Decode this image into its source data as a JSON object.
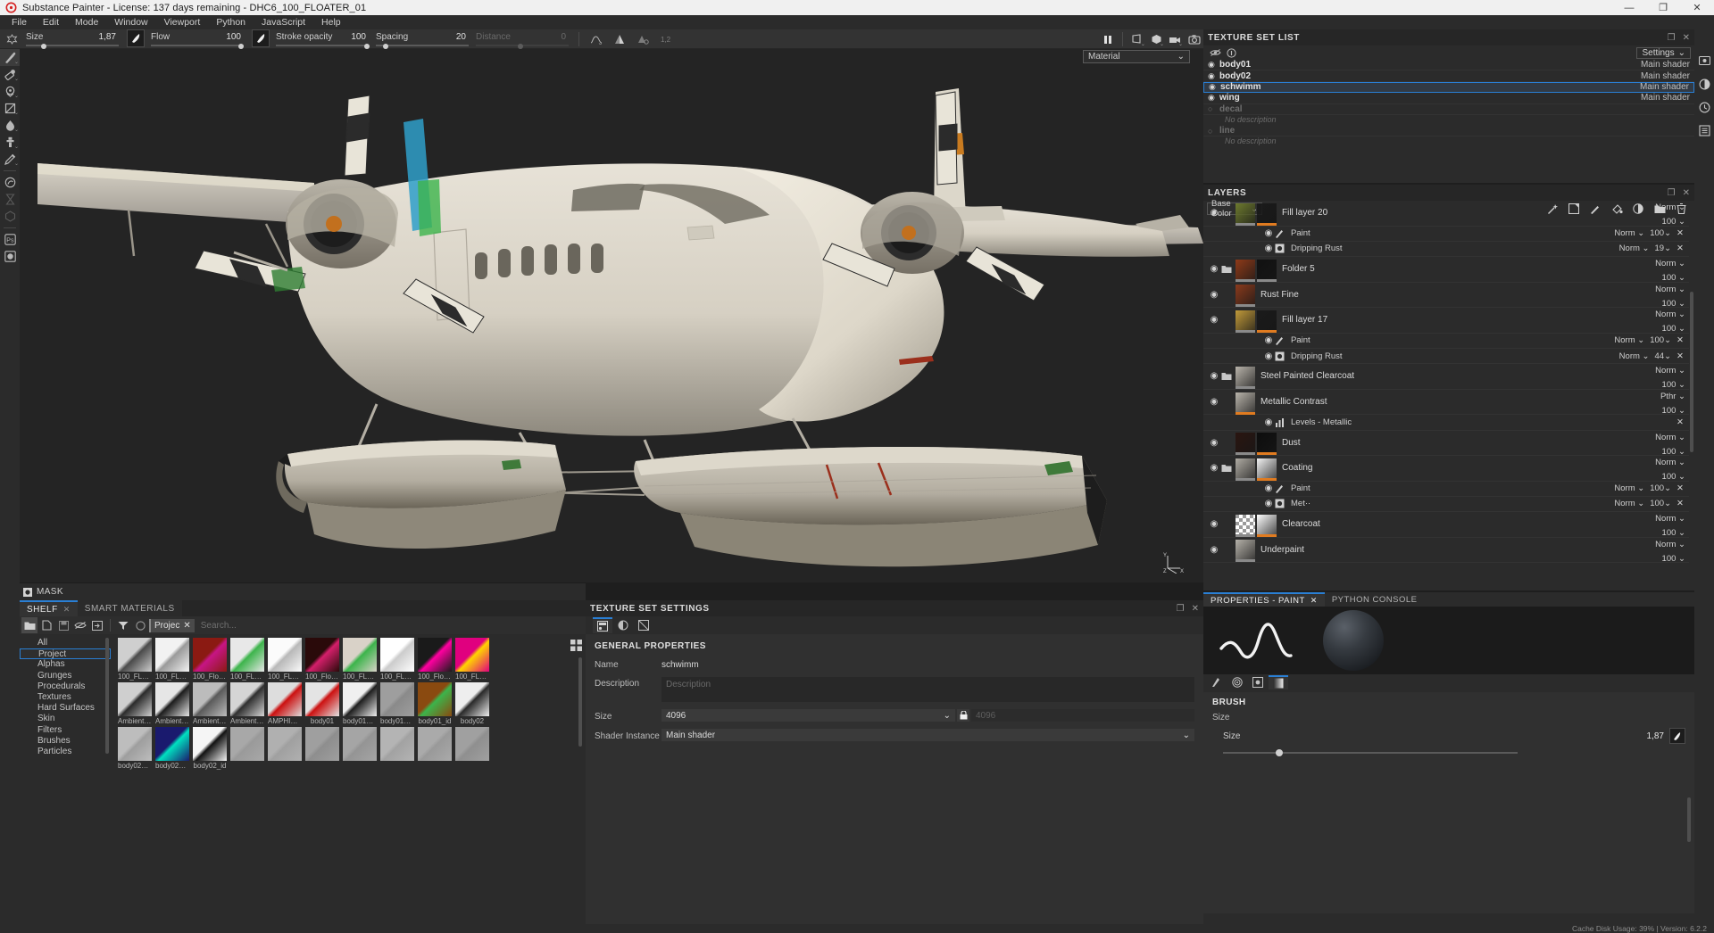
{
  "window": {
    "title": "Substance Painter - License: 137 days remaining - DHC6_100_FLOATER_01",
    "app_icon": "substance-painter-logo",
    "minimize": "—",
    "maximize": "❐",
    "close": "✕"
  },
  "menu": {
    "items": [
      "File",
      "Edit",
      "Mode",
      "Window",
      "Viewport",
      "Python",
      "JavaScript",
      "Help"
    ]
  },
  "params": {
    "fields": [
      {
        "label": "Size",
        "value": "1,87",
        "knob_pct": 18,
        "disabled": false
      },
      {
        "label": "Flow",
        "value": "100",
        "knob_pct": 92,
        "disabled": false
      },
      {
        "label": "Stroke opacity",
        "value": "100",
        "knob_pct": 93,
        "disabled": false
      },
      {
        "label": "Spacing",
        "value": "20",
        "knob_pct": 10,
        "disabled": false
      },
      {
        "label": "Distance",
        "value": "0",
        "knob_pct": 45,
        "disabled": true
      }
    ],
    "icons": [
      "lazy-mouse-icon",
      "symmetry-icon",
      "symmetry-settings-icon",
      "tri-planar-icon"
    ]
  },
  "tools": [
    {
      "name": "paint-tool",
      "glyph": "brush",
      "active": true,
      "disabled": false
    },
    {
      "name": "eraser-tool",
      "glyph": "eraser",
      "active": false,
      "disabled": false
    },
    {
      "name": "projection-tool",
      "glyph": "projection",
      "active": false,
      "disabled": false
    },
    {
      "name": "polygon-fill-tool",
      "glyph": "polyfill",
      "active": false,
      "disabled": false
    },
    {
      "name": "smudge-tool",
      "glyph": "smudge",
      "active": false,
      "disabled": false
    },
    {
      "name": "clone-tool",
      "glyph": "clone",
      "active": false,
      "disabled": false
    },
    {
      "name": "material-picker-tool",
      "glyph": "picker",
      "active": false,
      "disabled": false
    },
    {
      "name": "physics-tool",
      "glyph": "physics",
      "active": false,
      "disabled": false
    },
    {
      "name": "particles-tool",
      "glyph": "particles",
      "active": false,
      "disabled": true
    },
    {
      "name": "bake-tool",
      "glyph": "bake",
      "active": false,
      "disabled": true
    },
    {
      "name": "photoshop-link-tool",
      "glyph": "ps",
      "active": false,
      "disabled": false
    },
    {
      "name": "render-mode-tool",
      "glyph": "render",
      "active": false,
      "disabled": false
    }
  ],
  "viewport": {
    "material_select": "Material",
    "chevron": "⌄",
    "top_icons": [
      "pause-icon",
      "view-mode-icon",
      "shader-mode-icon",
      "camera-mode-icon",
      "screenshot-icon"
    ],
    "axis_labels": {
      "y": "Y",
      "x": "X",
      "z": "Z"
    }
  },
  "mask_bar": {
    "label": "MASK",
    "icon": "mask-icon"
  },
  "shelf": {
    "tabs": [
      {
        "label": "SHELF",
        "closable": true,
        "active": true
      },
      {
        "label": "SMART MATERIALS",
        "closable": false,
        "active": false
      }
    ],
    "toolbar_icons": [
      "folder-icon",
      "new-icon",
      "save-icon",
      "hide-icon",
      "import-icon",
      "filter-icon",
      "circle-icon"
    ],
    "chip": "Projec",
    "chip_close": "✕",
    "search_placeholder": "Search...",
    "categories": [
      {
        "label": "All",
        "selected": false
      },
      {
        "label": "Project",
        "selected": true
      },
      {
        "label": "Alphas",
        "selected": false
      },
      {
        "label": "Grunges",
        "selected": false
      },
      {
        "label": "Procedurals",
        "selected": false
      },
      {
        "label": "Textures",
        "selected": false
      },
      {
        "label": "Hard Surfaces",
        "selected": false
      },
      {
        "label": "Skin",
        "selected": false
      },
      {
        "label": "Filters",
        "selected": false
      },
      {
        "label": "Brushes",
        "selected": false
      },
      {
        "label": "Particles",
        "selected": false
      }
    ],
    "grid_rows": [
      [
        {
          "name": "100_FLOAT...",
          "c1": "#cfcfcf",
          "c2": "#4a4a4a"
        },
        {
          "name": "100_FLOAT...",
          "c1": "#f2f2f2",
          "c2": "#9a9a9a"
        },
        {
          "name": "100_Floater...",
          "c1": "#8b1a12",
          "c2": "#c71585"
        },
        {
          "name": "100_FLOAT...",
          "c1": "#e8e8e8",
          "c2": "#3cb44b"
        },
        {
          "name": "100_FLOAT...",
          "c1": "#fbfbfb",
          "c2": "#b8b8b8"
        },
        {
          "name": "100_Floater...",
          "c1": "#2a0a0a",
          "c2": "#d41f6a"
        },
        {
          "name": "100_FLOAT...",
          "c1": "#d9d2c8",
          "c2": "#3cb44b"
        },
        {
          "name": "100_FLOAT...",
          "c1": "#ffffff",
          "c2": "#cccccc"
        },
        {
          "name": "100_Floater...",
          "c1": "#1a1a1a",
          "c2": "#ff00a0"
        },
        {
          "name": "100_FLOAT...",
          "c1": "#e0007f",
          "c2": "#ffd400"
        }
      ],
      [
        {
          "name": "Ambient O...",
          "c1": "#cfcfcf",
          "c2": "#2b2b2b"
        },
        {
          "name": "Ambient O...",
          "c1": "#e6e6e6",
          "c2": "#1c1c1c"
        },
        {
          "name": "Ambient O...",
          "c1": "#bcbcbc",
          "c2": "#5a5a5a"
        },
        {
          "name": "Ambient O...",
          "c1": "#d5d5d5",
          "c2": "#2f2f2f"
        },
        {
          "name": "AMPHIBST...",
          "c1": "#dddddd",
          "c2": "#cc1111"
        },
        {
          "name": "body01",
          "c1": "#e4e4e4",
          "c2": "#cc1111"
        },
        {
          "name": "body01_ao",
          "c1": "#f0f0f0",
          "c2": "#1e1e1e"
        },
        {
          "name": "body01_cu...",
          "c1": "#9e9e9e",
          "c2": "#8a8a8a"
        },
        {
          "name": "body01_id",
          "c1": "#8a4a10",
          "c2": "#3cb44b"
        },
        {
          "name": "body02",
          "c1": "#eeeeee",
          "c2": "#2a2a2a"
        }
      ],
      [
        {
          "name": "body02_ao",
          "c1": "#bdbdbd",
          "c2": "#9e9e9e"
        },
        {
          "name": "body02_cu...",
          "c1": "#1a1a6e",
          "c2": "#00e0c0"
        },
        {
          "name": "body02_id",
          "c1": "#f5f5f5",
          "c2": "#121212"
        },
        {
          "name": "",
          "c1": "#a8a8a8",
          "c2": "#9a9a9a"
        },
        {
          "name": "",
          "c1": "#b0b0b0",
          "c2": "#a0a0a0"
        },
        {
          "name": "",
          "c1": "#9f9f9f",
          "c2": "#8e8e8e"
        },
        {
          "name": "",
          "c1": "#a5a5a5",
          "c2": "#949494"
        },
        {
          "name": "",
          "c1": "#b4b4b4",
          "c2": "#a2a2a2"
        },
        {
          "name": "",
          "c1": "#aaaaaa",
          "c2": "#999999"
        },
        {
          "name": "",
          "c1": "#a0a0a0",
          "c2": "#8f8f8f"
        }
      ]
    ]
  },
  "texture_set_settings": {
    "title": "TEXTURE SET SETTINGS",
    "maximize_icon": "❐",
    "close_icon": "✕",
    "tabs": [
      "texture-set-icon",
      "channel-icon",
      "uv-icon"
    ],
    "section": "GENERAL PROPERTIES",
    "name_label": "Name",
    "name_value": "schwimm",
    "description_label": "Description",
    "description_placeholder": "Description",
    "size_label": "Size",
    "size_value": "4096",
    "size_locked_value": "4096",
    "lock_icon": "lock-icon",
    "shader_label": "Shader Instance",
    "shader_value": "Main shader",
    "chevron": "⌄"
  },
  "texture_set_list": {
    "title": "TEXTURE SET LIST",
    "maximize_icon": "❐",
    "close_icon": "✕",
    "toolbar_icons": [
      "hide-all-icon",
      "info-icon"
    ],
    "settings_label": "Settings",
    "settings_chevron": "⌄",
    "sets": [
      {
        "name": "body01",
        "shader": "Main shader",
        "visible": true,
        "selected": false,
        "description": null
      },
      {
        "name": "body02",
        "shader": "Main shader",
        "visible": true,
        "selected": false,
        "description": null
      },
      {
        "name": "schwimm",
        "shader": "Main shader",
        "visible": true,
        "selected": true,
        "description": null
      },
      {
        "name": "wing",
        "shader": "Main shader",
        "visible": true,
        "selected": false,
        "description": null
      },
      {
        "name": "decal",
        "shader": "",
        "visible": false,
        "selected": false,
        "description": "No description"
      },
      {
        "name": "line",
        "shader": "",
        "visible": false,
        "selected": false,
        "description": "No description"
      }
    ]
  },
  "layers": {
    "title": "LAYERS",
    "maximize_icon": "❐",
    "close_icon": "✕",
    "channel": "Base Color",
    "channel_chevron": "⌄",
    "toolbar_icons": [
      "effect-icon",
      "mask-icon",
      "paint-layer-icon",
      "fill-layer-icon",
      "adjustment-icon",
      "folder-icon",
      "trash-icon"
    ],
    "items": [
      {
        "type": "layer",
        "name": "Fill layer 20",
        "blend": "Norm",
        "opacity": "100",
        "visible": true,
        "thumb": "#6d7a2e",
        "thumb2": "#1a1a1a",
        "bar1": "#8a8a8a",
        "bar2": "#e07b20",
        "folder": false
      },
      {
        "type": "effect",
        "name": "Paint",
        "icon": "paint-icon",
        "blend": "Norm",
        "opacity": "100",
        "visible": true
      },
      {
        "type": "effect",
        "name": "Dripping Rust",
        "icon": "mask-icon",
        "blend": "Norm",
        "opacity": "19",
        "visible": true
      },
      {
        "type": "layer",
        "name": "Folder 5",
        "blend": "Norm",
        "opacity": "100",
        "visible": true,
        "thumb": "#8f3a18",
        "thumb2": "#111111",
        "bar1": "#8a8a8a",
        "bar2": "#8a8a8a",
        "folder": true
      },
      {
        "type": "layer",
        "name": "Rust Fine",
        "blend": "Norm",
        "opacity": "100",
        "visible": true,
        "thumb": "#8a3a1c",
        "thumb2": null,
        "bar1": "#8a8a8a",
        "bar2": null,
        "folder": false
      },
      {
        "type": "layer",
        "name": "Fill layer 17",
        "blend": "Norm",
        "opacity": "100",
        "visible": true,
        "thumb": "#c19a3a",
        "thumb2": "#1a1a1a",
        "bar1": "#8a8a8a",
        "bar2": "#e07b20",
        "folder": false
      },
      {
        "type": "effect",
        "name": "Paint",
        "icon": "paint-icon",
        "blend": "Norm",
        "opacity": "100",
        "visible": true
      },
      {
        "type": "effect",
        "name": "Dripping Rust",
        "icon": "mask-icon",
        "blend": "Norm",
        "opacity": "44",
        "visible": true
      },
      {
        "type": "layer",
        "name": "Steel Painted Clearcoat",
        "blend": "Norm",
        "opacity": "100",
        "visible": true,
        "thumb": "#b9b4ab",
        "thumb2": null,
        "bar1": "#8a8a8a",
        "bar2": null,
        "folder": true
      },
      {
        "type": "layer",
        "name": "Metallic Contrast",
        "blend": "Pthr",
        "opacity": "100",
        "visible": true,
        "thumb": "#b9b4ab",
        "thumb2": null,
        "bar1": "#e07b20",
        "bar2": null,
        "folder": false
      },
      {
        "type": "effect",
        "name": "Levels - Metallic",
        "icon": "levels-icon",
        "blend": null,
        "opacity": null,
        "visible": true
      },
      {
        "type": "layer",
        "name": "Dust",
        "blend": "Norm",
        "opacity": "100",
        "visible": true,
        "thumb": "#2a1510",
        "thumb2": "#0d0d0d",
        "bar1": "#8a8a8a",
        "bar2": "#e07b20",
        "folder": false
      },
      {
        "type": "layer",
        "name": "Coating",
        "blend": "Norm",
        "opacity": "100",
        "visible": true,
        "thumb": "#b0aca4",
        "thumb2": "#f2f2f2",
        "bar1": "#8a8a8a",
        "bar2": "#e07b20",
        "folder": true
      },
      {
        "type": "effect",
        "name": "Paint",
        "icon": "paint-icon",
        "blend": "Norm",
        "opacity": "100",
        "visible": true
      },
      {
        "type": "effect",
        "name": "Met··",
        "icon": "mask-icon",
        "blend": "Norm",
        "opacity": "100",
        "visible": true
      },
      {
        "type": "layer",
        "name": "Clearcoat",
        "blend": "Norm",
        "opacity": "100",
        "visible": true,
        "thumb": "checker",
        "thumb2": "#ffffff",
        "bar1": "#8a8a8a",
        "bar2": "#e07b20",
        "folder": false
      },
      {
        "type": "layer",
        "name": "Underpaint",
        "blend": "Norm",
        "opacity": "100",
        "visible": true,
        "thumb": "#b5b1a9",
        "thumb2": null,
        "bar1": "#8a8a8a",
        "bar2": null,
        "folder": false
      }
    ]
  },
  "properties": {
    "tabs": [
      {
        "label": "PROPERTIES - PAINT",
        "closable": true,
        "active": true
      },
      {
        "label": "PYTHON CONSOLE",
        "closable": false,
        "active": false
      }
    ],
    "brush_tabs": [
      "stroke-icon",
      "alpha-icon",
      "stencil-icon",
      "gradient-icon"
    ],
    "section": "BRUSH",
    "subsection": "Size",
    "size_label": "Size",
    "size_value": "1,87",
    "size_knob_pct": 18
  },
  "right_rail": [
    "display-settings-icon",
    "shader-settings-icon",
    "history-icon",
    "log-icon"
  ],
  "status": {
    "text": "Cache Disk Usage:   39% | Version: 6.2.2"
  },
  "colors": {
    "accent": "#2a7fd4",
    "orange": "#e07b20",
    "panel": "#2b2b2b",
    "viewport_bg": "#242424"
  }
}
